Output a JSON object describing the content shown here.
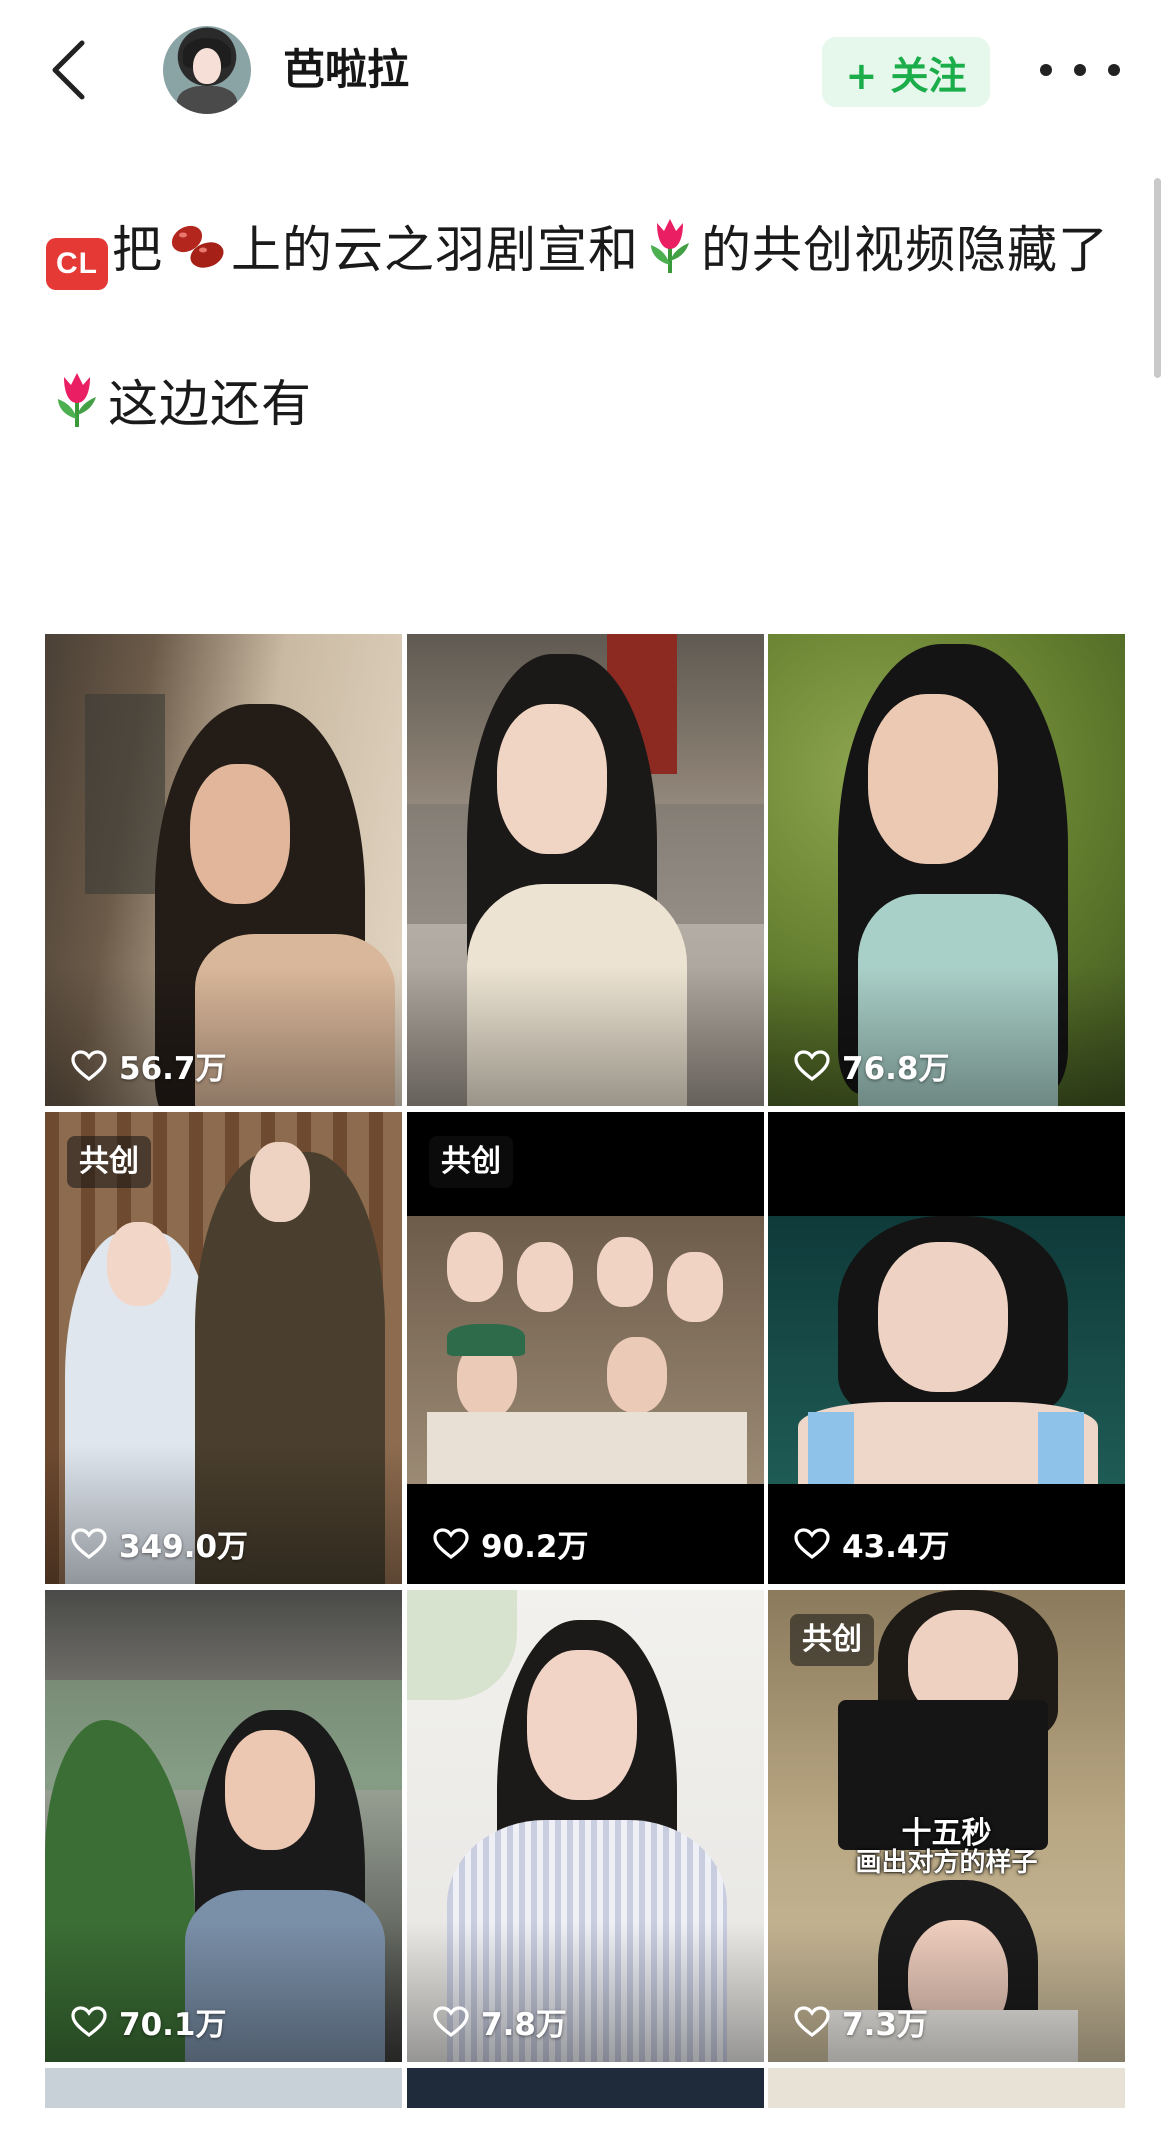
{
  "header": {
    "back_icon": "chevron-left-icon",
    "username": "芭啦拉",
    "follow_label": "+ 关注",
    "more_icon": "more-dots-icon"
  },
  "post": {
    "line1_part1": "把",
    "line1_part2": "上的云之羽剧宣和",
    "line1_part3": "的共创视频隐藏了",
    "cl_emoji_text": "CL",
    "line2": "这边还有"
  },
  "videos": [
    {
      "likes": "56.7万",
      "badge": ""
    },
    {
      "likes": "",
      "badge": ""
    },
    {
      "likes": "76.8万",
      "badge": ""
    },
    {
      "likes": "349.0万",
      "badge": "共创"
    },
    {
      "likes": "90.2万",
      "badge": "共创"
    },
    {
      "likes": "43.4万",
      "badge": ""
    },
    {
      "likes": "70.1万",
      "badge": ""
    },
    {
      "likes": "7.8万",
      "badge": ""
    },
    {
      "likes": "7.3万",
      "badge": "共创"
    }
  ],
  "overlay_caption": {
    "line1": "十五秒",
    "line2": "画出对方的样子"
  },
  "colors": {
    "follow_bg": "#e6f7ec",
    "follow_text": "#1aad4a",
    "badge_bg": "rgba(20,20,20,0.55)"
  }
}
